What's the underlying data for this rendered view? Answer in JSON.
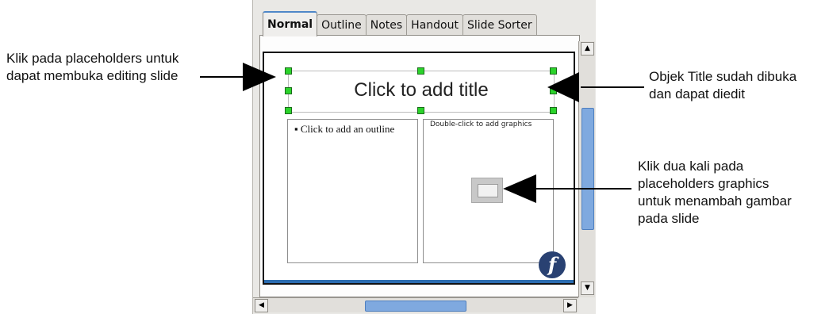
{
  "annotations": {
    "left": [
      "Klik pada placeholders untuk",
      "dapat membuka editing slide"
    ],
    "right_top": [
      "Objek Title sudah dibuka",
      "dan dapat diedit"
    ],
    "right_bottom": [
      "Klik dua kali pada",
      "placeholders graphics",
      "untuk menambah gambar",
      "pada slide"
    ]
  },
  "tabs": [
    {
      "label": "Normal",
      "active": true
    },
    {
      "label": "Outline",
      "active": false
    },
    {
      "label": "Notes",
      "active": false
    },
    {
      "label": "Handout",
      "active": false
    },
    {
      "label": "Slide Sorter",
      "active": false
    }
  ],
  "slide": {
    "title_placeholder": "Click to add title",
    "outline_placeholder": "Click to add an outline",
    "graphics_placeholder": "Double-click to add graphics",
    "logo": "fedora-logo"
  },
  "colors": {
    "selection_handle": "#2bd32b",
    "scroll_thumb": "#7fa9df",
    "slide_footer_bar": "#2b6cb0"
  },
  "icons": {
    "scroll_up": "▲",
    "scroll_down": "▼",
    "scroll_left": "◀",
    "scroll_right": "▶"
  }
}
